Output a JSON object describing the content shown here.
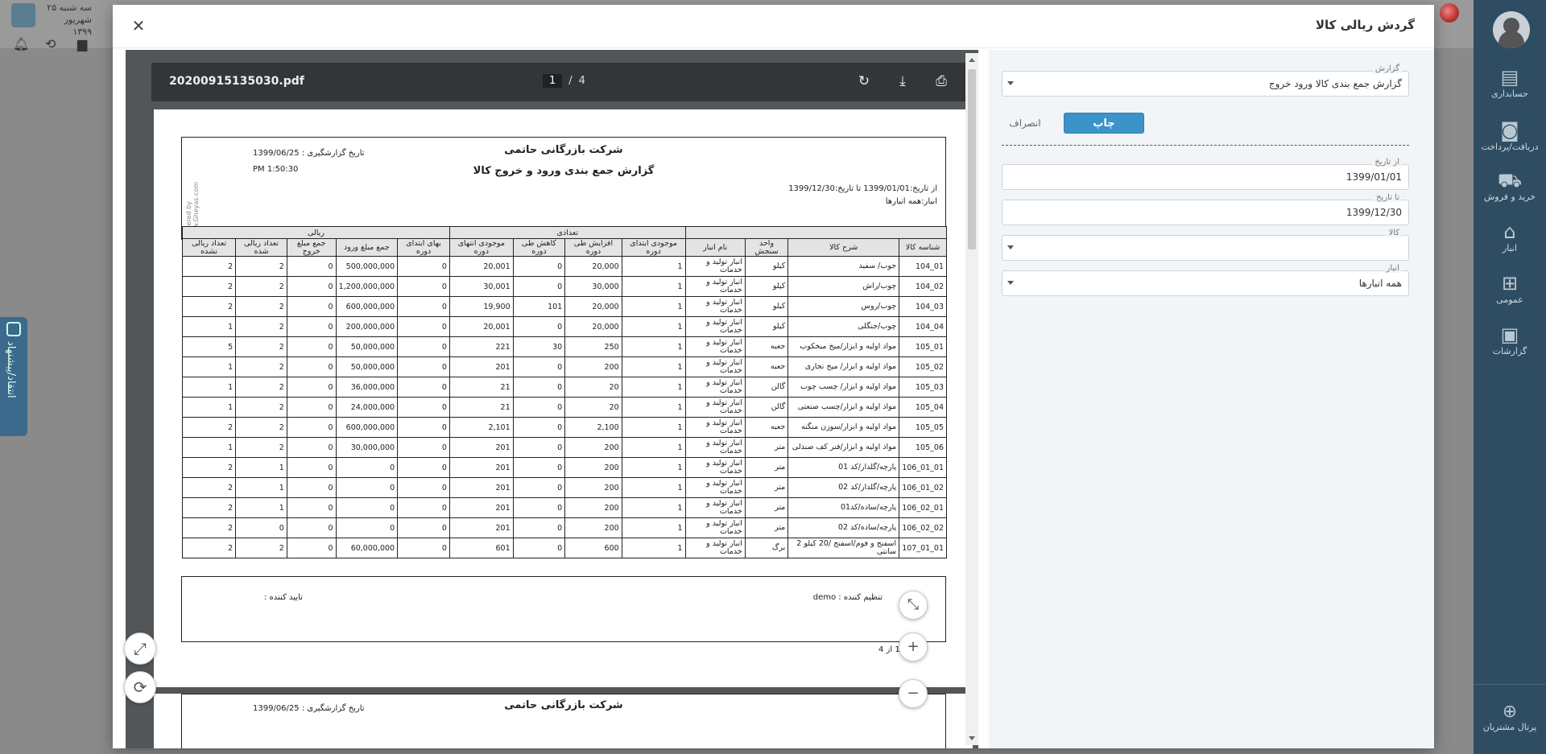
{
  "background": {
    "date_line1": "سه شنبه ۲۵",
    "date_line2": "شهریور ۱۳۹۹"
  },
  "feedback_tab": "انتقاد/پیشنهاد",
  "sidebar": {
    "items": [
      {
        "label": "حسابداری",
        "icon": "ledger-icon"
      },
      {
        "label": "دریافت/پرداخت",
        "icon": "cash-icon"
      },
      {
        "label": "خرید و فروش",
        "icon": "cart-icon"
      },
      {
        "label": "انبار",
        "icon": "warehouse-icon"
      },
      {
        "label": "عمومی",
        "icon": "grid-icon"
      },
      {
        "label": "گزارشات",
        "icon": "clipboard-icon"
      }
    ],
    "portal_label": "پرتال مشتریان"
  },
  "modal": {
    "title": "گردش ریالی کالا"
  },
  "form": {
    "report": {
      "label": "گزارش",
      "value": "گزارش جمع بندی کالا ورود خروج"
    },
    "print_label": "چاپ",
    "cancel_label": "انصراف",
    "from_date": {
      "label": "از تاریخ",
      "value": "1399/01/01"
    },
    "to_date": {
      "label": "تا تاریخ",
      "value": "1399/12/30"
    },
    "item": {
      "label": "کالا",
      "value": ""
    },
    "store": {
      "label": "انبار",
      "value": "همه انبارها"
    }
  },
  "pdf": {
    "filename": "20200915135030.pdf",
    "current_page": "1",
    "total_pages": "4",
    "page_sep": "/"
  },
  "report": {
    "powered": "powered by www.Gheyas.com",
    "company": "شرکت بازرگانی حاتمی",
    "title": "گزارش جمع بندی ورود و خروج کالا",
    "report_date": "تاریخ گزارشگیری : 1399/06/25",
    "report_time": "PM 1:50:30",
    "range": "از تاریخ:1399/01/01   تا تاریخ:1399/12/30",
    "store": "انبار:همه انبارها",
    "group_headers": {
      "quantity": "تعدادی",
      "rial": "ریالی"
    },
    "columns": [
      "شناسه کالا",
      "شرح کالا",
      "واحد سنجش",
      "نام انبار",
      "موجودی ابتدای دوره",
      "افزایش طی دوره",
      "کاهش طی دوره",
      "موجودی انتهای دوره",
      "بهای ابتدای دوره",
      "جمع مبلغ ورود",
      "جمع مبلغ خروج",
      "تعداد ریالی شده",
      "تعداد ریالی نشده"
    ],
    "rows": [
      [
        "104_01",
        "جوب/ سفید",
        "کیلو",
        "انبار تولید و خدمات",
        "1",
        "20,000",
        "0",
        "20,001",
        "0",
        "500,000,000",
        "0",
        "2",
        "2"
      ],
      [
        "104_02",
        "چوب/راش",
        "کیلو",
        "انبار تولید و خدمات",
        "1",
        "30,000",
        "0",
        "30,001",
        "0",
        "1,200,000,000",
        "0",
        "2",
        "2"
      ],
      [
        "104_03",
        "چوب/روس",
        "کیلو",
        "انبار تولید و خدمات",
        "1",
        "20,000",
        "101",
        "19,900",
        "0",
        "600,000,000",
        "0",
        "2",
        "2"
      ],
      [
        "104_04",
        "چوب/جنگلی",
        "کیلو",
        "انبار تولید و خدمات",
        "1",
        "20,000",
        "0",
        "20,001",
        "0",
        "200,000,000",
        "0",
        "2",
        "1"
      ],
      [
        "105_01",
        "مواد اولیه و ابزار/میخ میخکوب",
        "جعبه",
        "انبار تولید و خدمات",
        "1",
        "250",
        "30",
        "221",
        "0",
        "50,000,000",
        "0",
        "2",
        "5"
      ],
      [
        "105_02",
        "مواد اولیه و ابزار/ میخ نجاری",
        "جعبه",
        "انبار تولید و خدمات",
        "1",
        "200",
        "0",
        "201",
        "0",
        "50,000,000",
        "0",
        "2",
        "1"
      ],
      [
        "105_03",
        "مواد اولیه و ابزار/ چسب چوب",
        "گالن",
        "انبار تولید و خدمات",
        "1",
        "20",
        "0",
        "21",
        "0",
        "36,000,000",
        "0",
        "2",
        "1"
      ],
      [
        "105_04",
        "مواد اولیه و ابزار/چسب صنعتی",
        "گالن",
        "انبار تولید و خدمات",
        "1",
        "20",
        "0",
        "21",
        "0",
        "24,000,000",
        "0",
        "2",
        "1"
      ],
      [
        "105_05",
        "مواد اولیه و ابزار/سوزن منگنه",
        "جعبه",
        "انبار تولید و خدمات",
        "1",
        "2,100",
        "0",
        "2,101",
        "0",
        "600,000,000",
        "0",
        "2",
        "2"
      ],
      [
        "105_06",
        "مواد اولیه و ابزار/فنر کف صندلی",
        "متر",
        "انبار تولید و خدمات",
        "1",
        "200",
        "0",
        "201",
        "0",
        "30,000,000",
        "0",
        "2",
        "1"
      ],
      [
        "106_01_01",
        "پارچه/گلدار/کد 01",
        "متر",
        "انبار تولید و خدمات",
        "1",
        "200",
        "0",
        "201",
        "0",
        "0",
        "0",
        "1",
        "2"
      ],
      [
        "106_01_02",
        "پارچه/گلدار/کد 02",
        "متر",
        "انبار تولید و خدمات",
        "1",
        "200",
        "0",
        "201",
        "0",
        "0",
        "0",
        "1",
        "2"
      ],
      [
        "106_02_01",
        "پارچه/ساده/کد01",
        "متر",
        "انبار تولید و خدمات",
        "1",
        "200",
        "0",
        "201",
        "0",
        "0",
        "0",
        "1",
        "2"
      ],
      [
        "106_02_02",
        "پارچه/ساده/کد 02",
        "متر",
        "انبار تولید و خدمات",
        "1",
        "200",
        "0",
        "201",
        "0",
        "0",
        "0",
        "0",
        "2"
      ],
      [
        "107_01_01",
        "اسفنج و فوم/اسفنج /20 کیلو 2 سانتی",
        "برگ",
        "انبار تولید و خدمات",
        "1",
        "600",
        "0",
        "601",
        "0",
        "60,000,000",
        "0",
        "2",
        "2"
      ]
    ],
    "signer": "تنظیم کننده : demo",
    "approver": "تایید کننده :",
    "page_footer": "صفحه 1 از 4"
  }
}
